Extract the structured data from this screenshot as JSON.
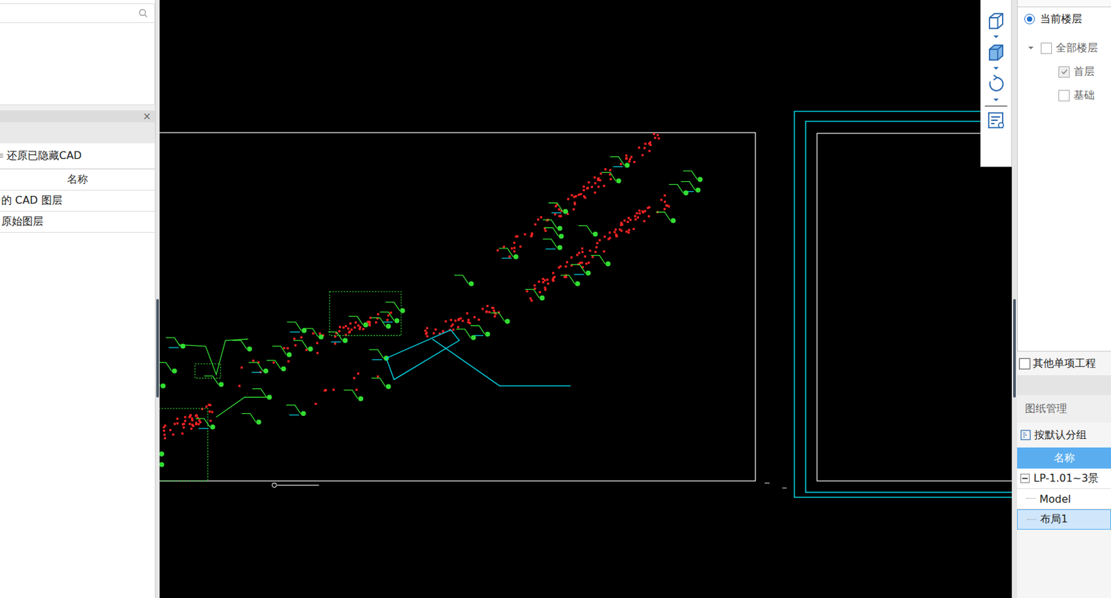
{
  "left_panel": {
    "search": {
      "placeholder": ""
    },
    "close": "×",
    "restore_button": "还原已隐藏CAD",
    "layer_table": {
      "columns": [
        "名称"
      ],
      "rows": [
        {
          "label": "的 CAD 图层",
          "selected": false
        },
        {
          "label": "原始图层",
          "selected": false
        }
      ]
    }
  },
  "floor_panel": {
    "scope": [
      {
        "label": "当前楼层",
        "selected": true
      }
    ],
    "tree": [
      {
        "label": "全部楼层",
        "kind": "parent",
        "expanded": true,
        "checked": false,
        "disabled": false
      },
      {
        "label": "首层",
        "kind": "child",
        "checked": true,
        "disabled": true
      },
      {
        "label": "基础",
        "kind": "child",
        "checked": false,
        "disabled": false
      }
    ],
    "other_projects": {
      "label": "其他单项工程",
      "checked": false
    }
  },
  "drawings": {
    "title": "图纸管理",
    "group_button": "按默认分组",
    "columns": [
      "名称"
    ],
    "rows": [
      {
        "label": "LP-1.01~3景",
        "kind": "parent",
        "expanded": true,
        "selected": false
      },
      {
        "label": "Model",
        "kind": "child",
        "selected": false
      },
      {
        "label": "布局1",
        "kind": "child",
        "selected": true
      }
    ]
  }
}
